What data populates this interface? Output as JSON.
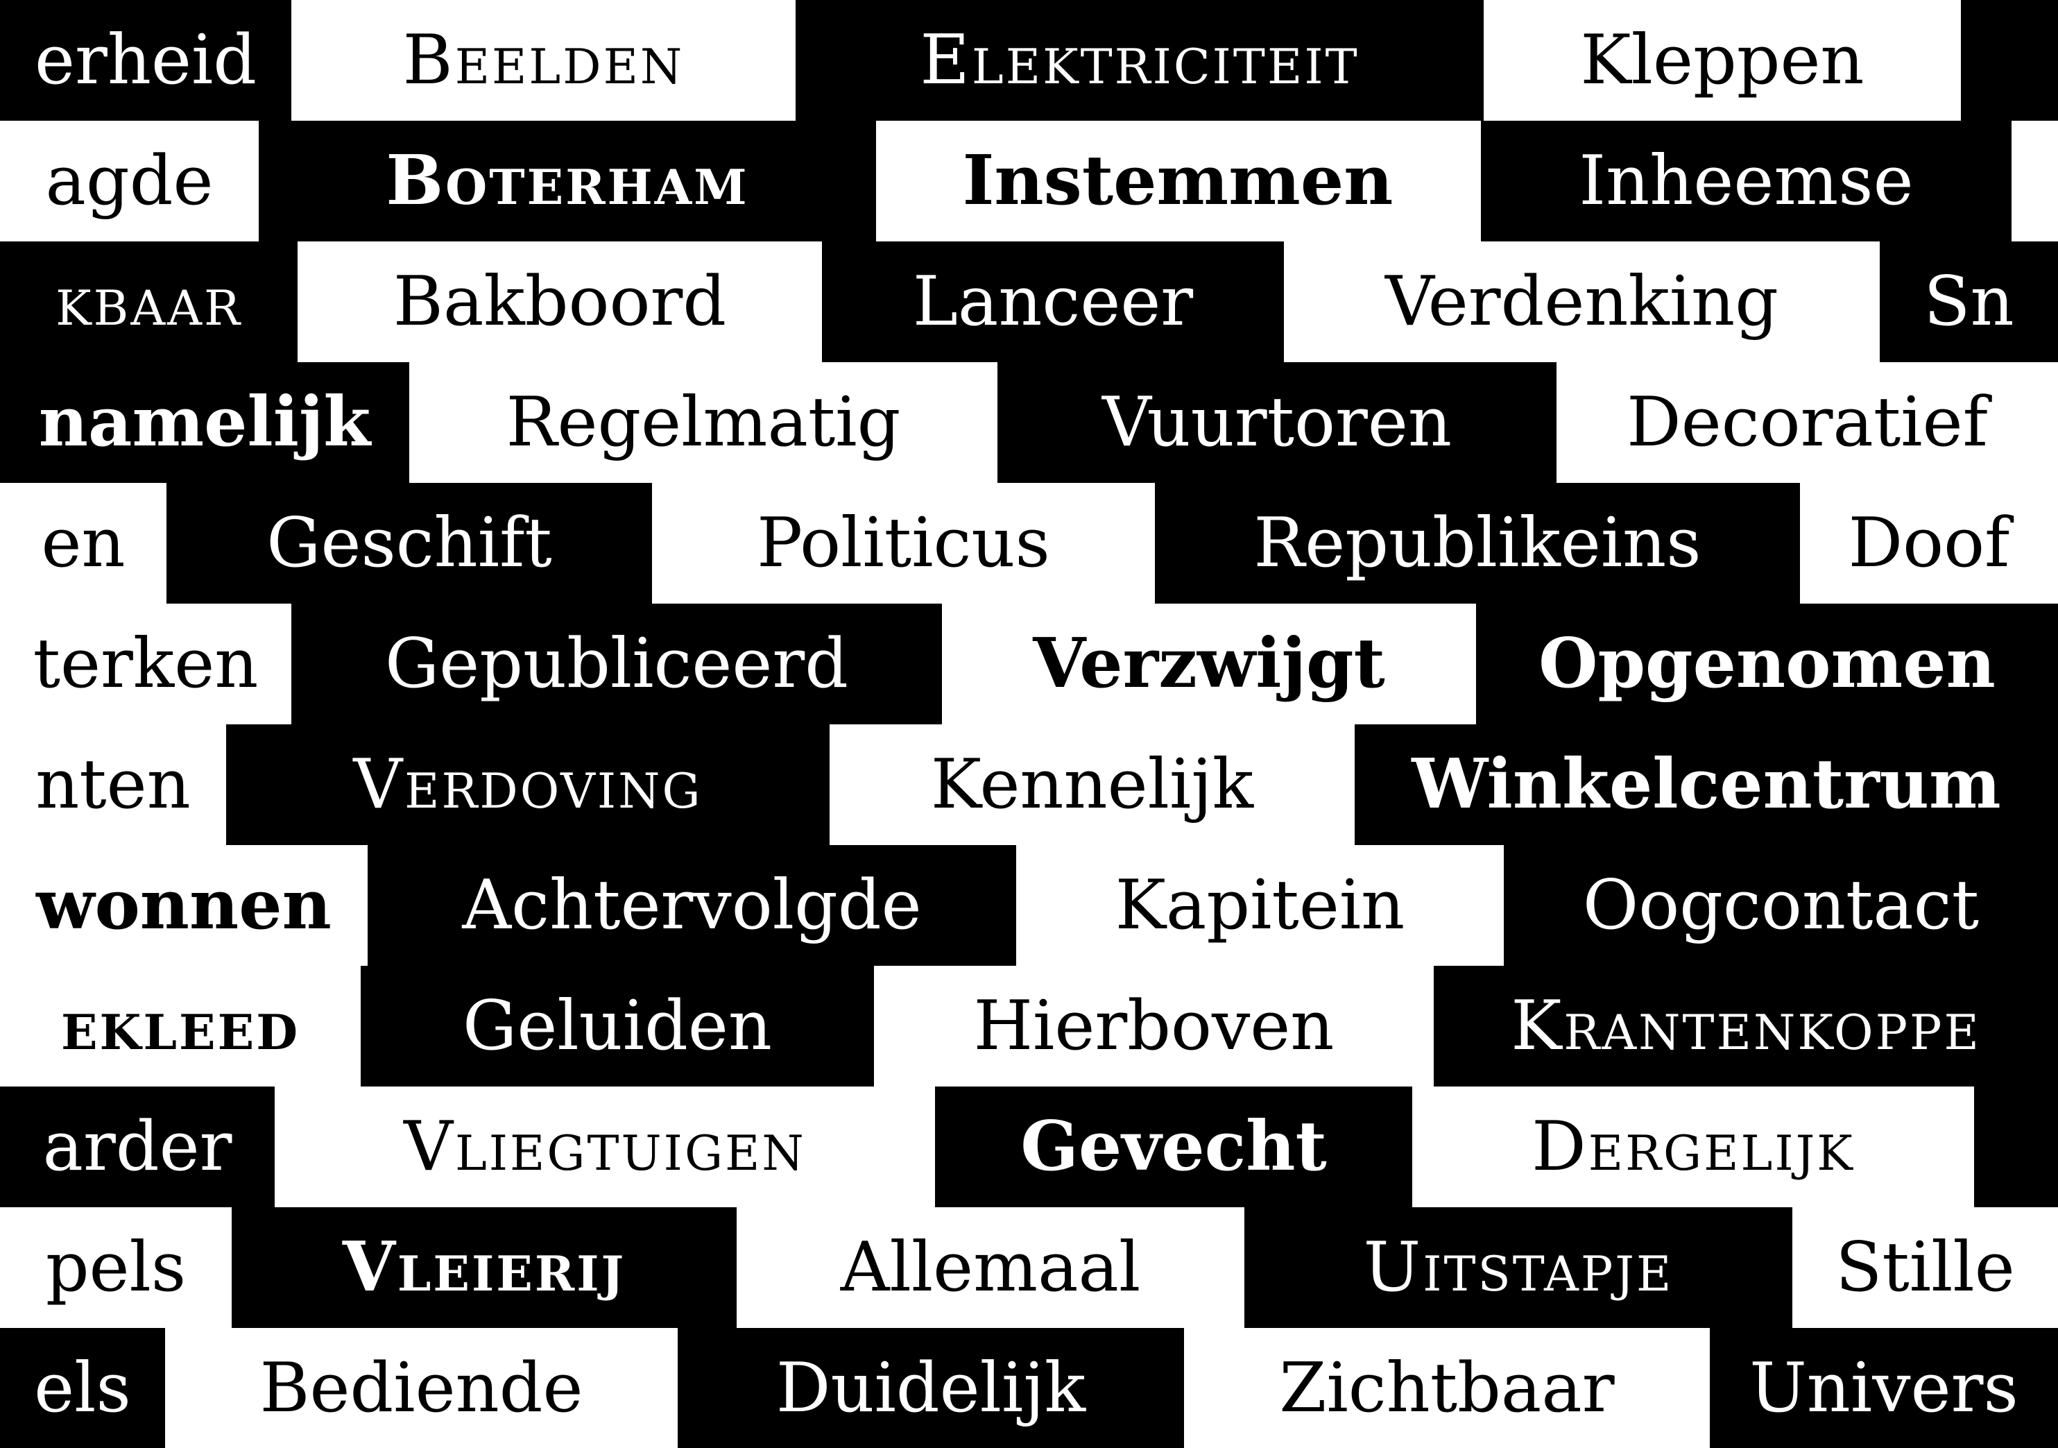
{
  "palette": {
    "dark": "#000000",
    "light": "#ffffff"
  },
  "words": [
    {
      "text": "erheid",
      "tone": "dark",
      "style": "regular"
    },
    {
      "text": "Beelden",
      "tone": "light",
      "style": "smallcaps"
    },
    {
      "text": "Elektriciteit",
      "tone": "dark",
      "style": "smallcaps"
    },
    {
      "text": "Kleppen",
      "tone": "light",
      "style": "regular"
    },
    {
      "text": "",
      "tone": "dark",
      "style": "regular"
    },
    {
      "text": "agde",
      "tone": "light",
      "style": "regular"
    },
    {
      "text": "Boterham",
      "tone": "dark",
      "style": "bold-smallcaps"
    },
    {
      "text": "Instemmen",
      "tone": "light",
      "style": "bold"
    },
    {
      "text": "Inheemse",
      "tone": "dark",
      "style": "regular"
    },
    {
      "text": "",
      "tone": "light",
      "style": "regular"
    },
    {
      "text": "kbaar",
      "tone": "dark",
      "style": "smallcaps"
    },
    {
      "text": "Bakboord",
      "tone": "light",
      "style": "regular"
    },
    {
      "text": "Lanceer",
      "tone": "dark",
      "style": "regular"
    },
    {
      "text": "Verdenking",
      "tone": "light",
      "style": "regular"
    },
    {
      "text": "Sn",
      "tone": "dark",
      "style": "regular"
    },
    {
      "text": "namelijk",
      "tone": "dark",
      "style": "bold"
    },
    {
      "text": "Regelmatig",
      "tone": "light",
      "style": "regular"
    },
    {
      "text": "Vuurtoren",
      "tone": "dark",
      "style": "regular"
    },
    {
      "text": "Decoratief",
      "tone": "light",
      "style": "regular"
    },
    {
      "text": "en",
      "tone": "light",
      "style": "regular"
    },
    {
      "text": "Geschift",
      "tone": "dark",
      "style": "regular"
    },
    {
      "text": "Politicus",
      "tone": "light",
      "style": "regular"
    },
    {
      "text": "Republikeins",
      "tone": "dark",
      "style": "regular"
    },
    {
      "text": "Doof",
      "tone": "light",
      "style": "regular"
    },
    {
      "text": "terken",
      "tone": "light",
      "style": "regular"
    },
    {
      "text": "Gepubliceerd",
      "tone": "dark",
      "style": "regular"
    },
    {
      "text": "Verzwijgt",
      "tone": "light",
      "style": "bold"
    },
    {
      "text": "Opgenomen",
      "tone": "dark",
      "style": "bold"
    },
    {
      "text": "nten",
      "tone": "light",
      "style": "regular"
    },
    {
      "text": "Verdoving",
      "tone": "dark",
      "style": "smallcaps"
    },
    {
      "text": "Kennelijk",
      "tone": "light",
      "style": "regular"
    },
    {
      "text": "Winkelcentrum",
      "tone": "dark",
      "style": "bold"
    },
    {
      "text": "wonnen",
      "tone": "light",
      "style": "bold"
    },
    {
      "text": "Achtervolgde",
      "tone": "dark",
      "style": "regular"
    },
    {
      "text": "Kapitein",
      "tone": "light",
      "style": "regular"
    },
    {
      "text": "Oogcontact",
      "tone": "dark",
      "style": "regular"
    },
    {
      "text": "ekleed",
      "tone": "light",
      "style": "bold-smallcaps"
    },
    {
      "text": "Geluiden",
      "tone": "dark",
      "style": "regular"
    },
    {
      "text": "Hierboven",
      "tone": "light",
      "style": "regular"
    },
    {
      "text": "Krantenkoppe",
      "tone": "dark",
      "style": "smallcaps"
    },
    {
      "text": "arder",
      "tone": "dark",
      "style": "regular"
    },
    {
      "text": "Vliegtuigen",
      "tone": "light",
      "style": "smallcaps"
    },
    {
      "text": "Gevecht",
      "tone": "dark",
      "style": "bold"
    },
    {
      "text": "Dergelijk",
      "tone": "light",
      "style": "smallcaps"
    },
    {
      "text": "",
      "tone": "dark",
      "style": "regular"
    },
    {
      "text": "pels",
      "tone": "light",
      "style": "regular"
    },
    {
      "text": "Vleierij",
      "tone": "dark",
      "style": "bold-smallcaps"
    },
    {
      "text": "Allemaal",
      "tone": "light",
      "style": "regular"
    },
    {
      "text": "Uitstapje",
      "tone": "dark",
      "style": "smallcaps"
    },
    {
      "text": "Stille",
      "tone": "light",
      "style": "regular"
    },
    {
      "text": "els",
      "tone": "dark",
      "style": "regular"
    },
    {
      "text": "Bediende",
      "tone": "light",
      "style": "regular"
    },
    {
      "text": "Duidelijk",
      "tone": "dark",
      "style": "regular"
    },
    {
      "text": "Zichtbaar",
      "tone": "light",
      "style": "regular"
    },
    {
      "text": "Univers",
      "tone": "dark",
      "style": "regular"
    }
  ]
}
